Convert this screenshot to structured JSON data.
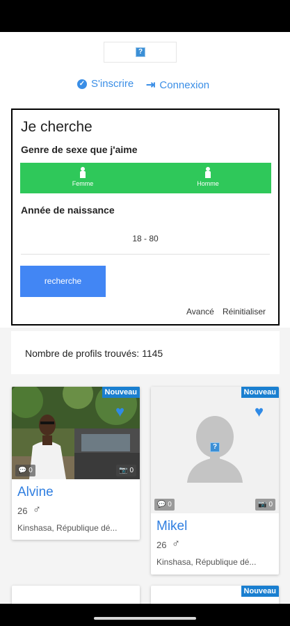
{
  "header": {
    "logo_icon": "question-icon",
    "register_label": "S'inscrire",
    "login_label": "Connexion",
    "accent_color": "#3a8ee6"
  },
  "search": {
    "title": "Je cherche",
    "gender_label": "Genre de sexe que j'aime",
    "gender_options": [
      "Femme",
      "Homme"
    ],
    "gender_color": "#2fc85a",
    "birth_year_label": "Année de naissance",
    "age_range": "18 - 80",
    "search_button": "recherche",
    "advanced_link": "Avancé",
    "reset_link": "Réinitialiser"
  },
  "results": {
    "count_text": "Nombre de profils trouvés: 1145"
  },
  "profiles": [
    {
      "badge": "Nouveau",
      "name": "Alvine",
      "age": "26",
      "gender_icon": "male-icon",
      "location": "Kinshasa, République dé...",
      "comments": "0",
      "photos": "0"
    },
    {
      "badge": "Nouveau",
      "name": "Mikel",
      "age": "26",
      "gender_icon": "male-icon",
      "location": "Kinshasa, République dé...",
      "comments": "0",
      "photos": "0"
    },
    {
      "badge": "Nouveau"
    }
  ]
}
